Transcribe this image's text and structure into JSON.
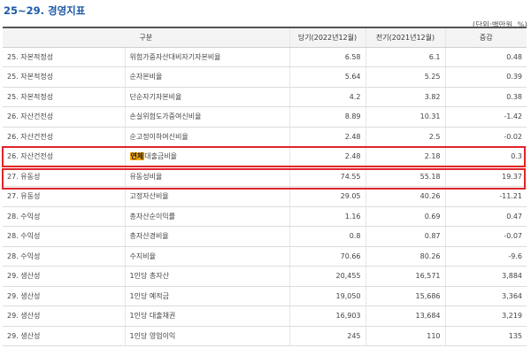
{
  "header": {
    "title": "25~29. 경영지표",
    "unit": "(단위:백만원, %)"
  },
  "table": {
    "columns": [
      "구분",
      "당기(2022년12월)",
      "전기(2021년12월)",
      "증감"
    ],
    "rows": [
      {
        "category": "25. 자본적정성",
        "item": "위험가중자산대비자기자본비율",
        "current": "6.58",
        "previous": "6.1",
        "change": "0.48"
      },
      {
        "category": "25. 자본적정성",
        "item": "순자본비율",
        "current": "5.64",
        "previous": "5.25",
        "change": "0.39"
      },
      {
        "category": "25. 자본적정성",
        "item": "단순자기자본비율",
        "current": "4.2",
        "previous": "3.82",
        "change": "0.38"
      },
      {
        "category": "26. 자산건전성",
        "item": "손실위험도가중여신비율",
        "current": "8.89",
        "previous": "10.31",
        "change": "-1.42"
      },
      {
        "category": "26. 자산건전성",
        "item": "순고정이하여신비율",
        "current": "2.48",
        "previous": "2.5",
        "change": "-0.02"
      },
      {
        "category": "26. 자산건전성",
        "item_highlight": "연체",
        "item_rest": "대출금비율",
        "current": "2.48",
        "previous": "2.18",
        "change": "0.3"
      },
      {
        "category": "27. 유동성",
        "item": "유동성비율",
        "current": "74.55",
        "previous": "55.18",
        "change": "19.37"
      },
      {
        "category": "27. 유동성",
        "item": "고정자산비율",
        "current": "29.05",
        "previous": "40.26",
        "change": "-11.21"
      },
      {
        "category": "28. 수익성",
        "item": "총자산순이익률",
        "current": "1.16",
        "previous": "0.69",
        "change": "0.47"
      },
      {
        "category": "28. 수익성",
        "item": "총자산경비율",
        "current": "0.8",
        "previous": "0.87",
        "change": "-0.07"
      },
      {
        "category": "28. 수익성",
        "item": "수지비율",
        "current": "70.66",
        "previous": "80.26",
        "change": "-9.6"
      },
      {
        "category": "29. 생산성",
        "item": "1인당 총자산",
        "current": "20,455",
        "previous": "16,571",
        "change": "3,884"
      },
      {
        "category": "29. 생산성",
        "item": "1인당 예적금",
        "current": "19,050",
        "previous": "15,686",
        "change": "3,364"
      },
      {
        "category": "29. 생산성",
        "item": "1인당 대출채권",
        "current": "16,903",
        "previous": "13,684",
        "change": "3,219"
      },
      {
        "category": "29. 생산성",
        "item": "1인당 영업이익",
        "current": "245",
        "previous": "110",
        "change": "135"
      }
    ]
  },
  "colors": {
    "title": "#1e5aa8",
    "highlight_box": "#e0242b",
    "text_highlight": "#f7a600",
    "header_bg": "#f4f4f4"
  }
}
